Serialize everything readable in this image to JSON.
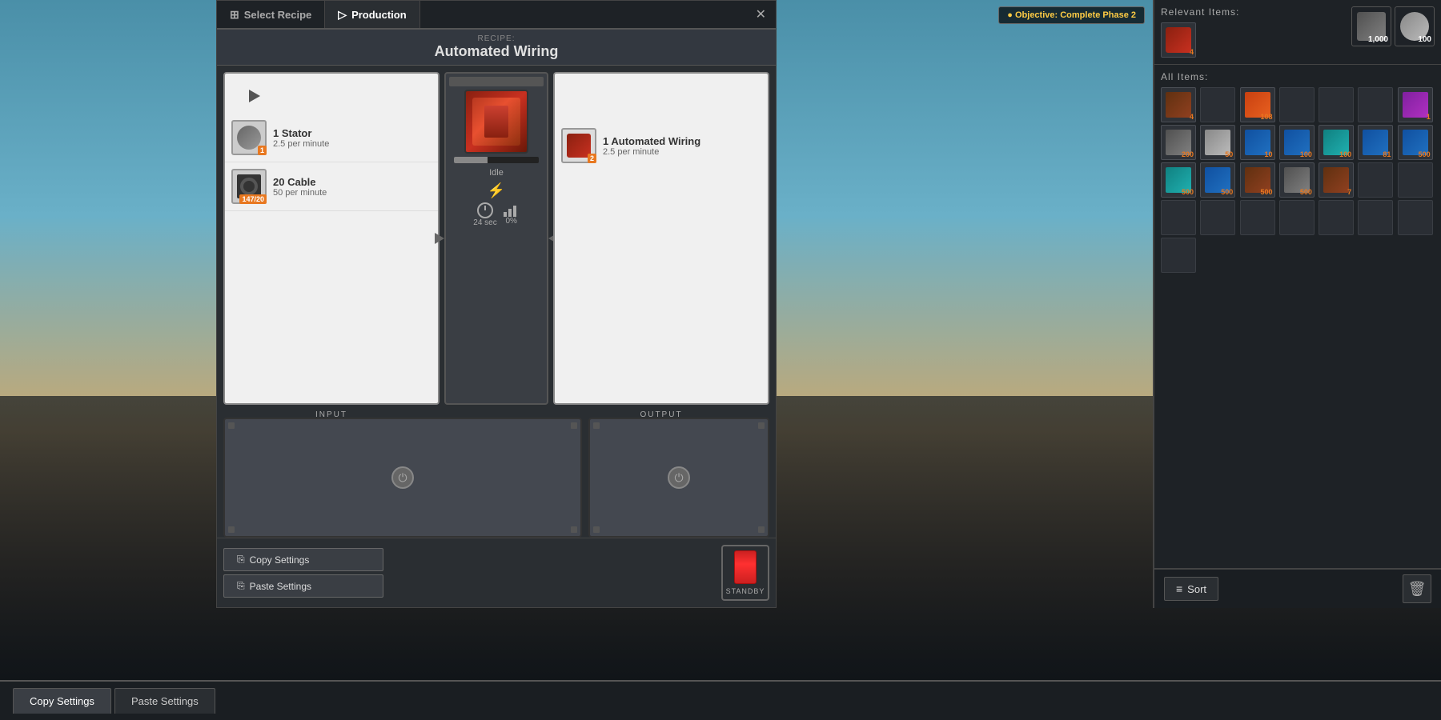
{
  "background": {
    "sky_color": "#5a9ab8",
    "ground_color": "#8a7050"
  },
  "tabs": {
    "select_recipe": "Select Recipe",
    "production": "Production",
    "close": "✕"
  },
  "recipe": {
    "label": "Recipe:",
    "name": "Automated Wiring"
  },
  "inputs": [
    {
      "name": "1 Stator",
      "rate": "2.5 per minute",
      "count": "1"
    },
    {
      "name": "20 Cable",
      "rate": "50 per minute",
      "count": "147/20"
    }
  ],
  "output": {
    "name": "1 Automated Wiring",
    "rate": "2.5 per minute",
    "count": "2"
  },
  "machine": {
    "status": "Idle",
    "time": "24 sec",
    "efficiency": "0%"
  },
  "buttons": {
    "copy_settings": "Copy Settings",
    "paste_settings": "Paste Settings",
    "standby": "STANDBY"
  },
  "panel_labels": {
    "input": "INPUT",
    "output": "OUTPUT"
  },
  "right_panel": {
    "relevant_title": "Relevant Items:",
    "all_title": "All Items:",
    "relevant_items": [
      {
        "count": "4"
      }
    ],
    "all_items_counts": [
      "4",
      "",
      "108",
      "",
      "",
      "",
      "",
      "1",
      "200",
      "50",
      "10",
      "100",
      "100",
      "81",
      "500",
      "500",
      "500",
      "500",
      "7",
      "",
      "",
      "",
      "",
      "",
      ""
    ]
  },
  "bottom_bar": {
    "copy_settings": "Copy Settings",
    "paste_settings": "Paste Settings"
  },
  "sort_btn": "Sort",
  "objective": "Complete Phase 2",
  "top_items": [
    {
      "count": "1,000"
    },
    {
      "count": "100"
    }
  ]
}
